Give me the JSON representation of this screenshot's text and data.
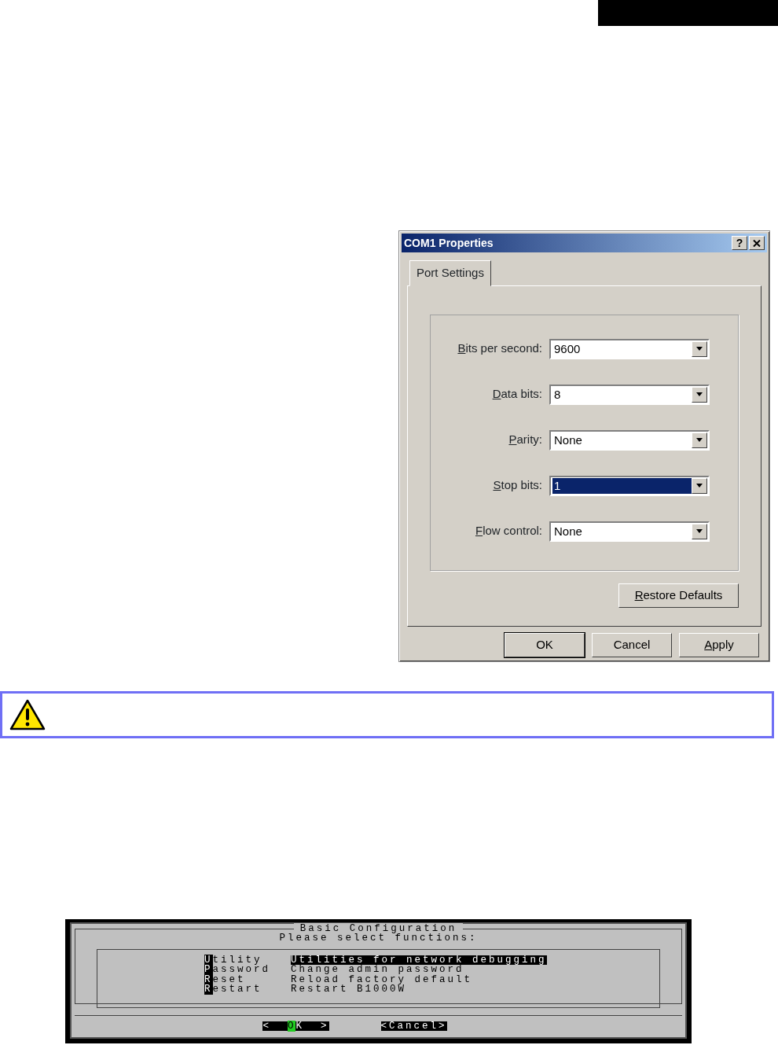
{
  "dialog": {
    "title": "COM1 Properties",
    "help_button": "?",
    "tabs": [
      {
        "label": "Port Settings",
        "selected": true
      }
    ],
    "fields": [
      {
        "label": "Bits per second:",
        "mnemonic": true,
        "value": "9600",
        "focused": false
      },
      {
        "label": "Data bits:",
        "mnemonic": true,
        "value": "8",
        "focused": false
      },
      {
        "label": "Parity:",
        "mnemonic": true,
        "value": "None",
        "focused": false
      },
      {
        "label": "Stop bits:",
        "mnemonic": true,
        "value": "1",
        "focused": true
      },
      {
        "label": "Flow control:",
        "mnemonic": true,
        "value": "None",
        "focused": false
      }
    ],
    "restore_button": {
      "label": "Restore Defaults",
      "mnemonic": true
    },
    "buttons": [
      {
        "label": "OK",
        "mnemonic": false,
        "default": true
      },
      {
        "label": "Cancel",
        "mnemonic": false,
        "default": false
      },
      {
        "label": "Apply",
        "mnemonic": true,
        "default": false
      }
    ]
  },
  "terminal": {
    "title": "Basic Configuration",
    "prompt": "Please select functions:",
    "items": [
      {
        "name": "Utility",
        "description": "Utilities for network debugging",
        "selected": true
      },
      {
        "name": "Password",
        "description": "Change admin password",
        "selected": false
      },
      {
        "name": "Reset",
        "description": "Reload factory default",
        "selected": false
      },
      {
        "name": "Restart",
        "description": "Restart B1000W",
        "selected": false
      }
    ],
    "buttons": [
      {
        "text": "<  OK  >",
        "selected": true
      },
      {
        "text": "<Cancel>",
        "selected": false
      }
    ]
  }
}
